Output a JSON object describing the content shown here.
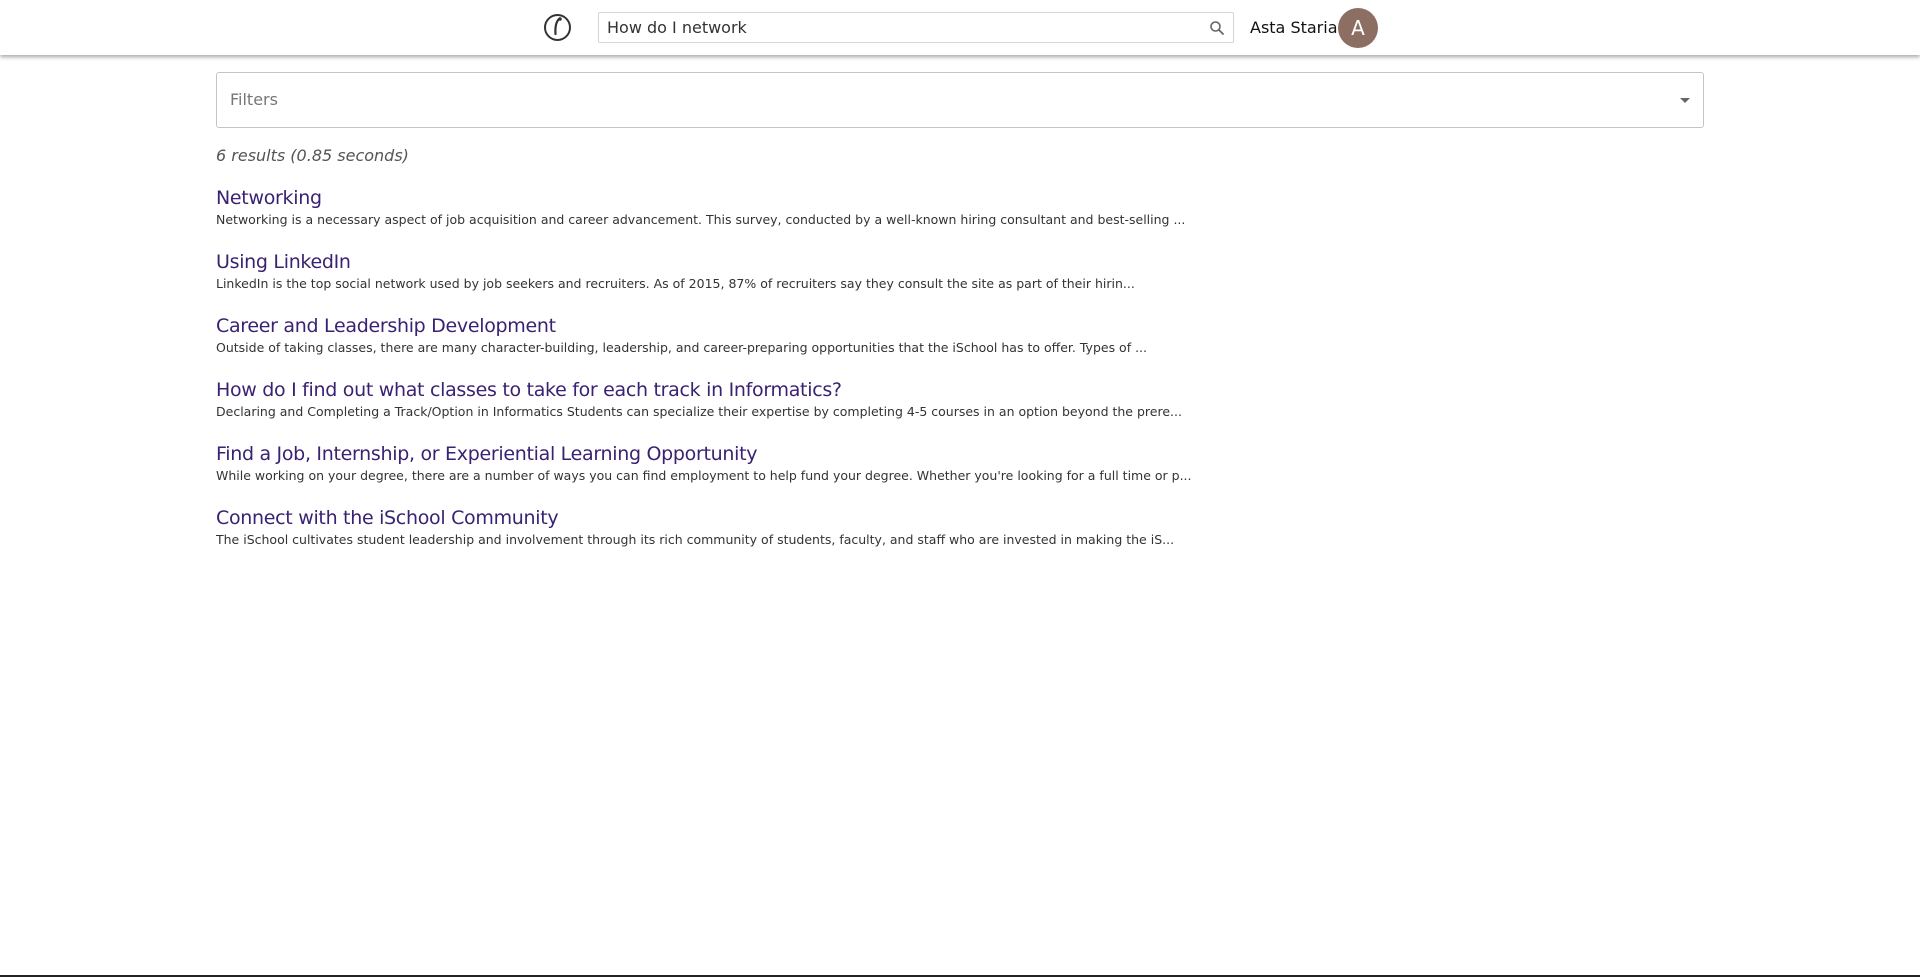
{
  "header": {
    "logo_icon": "ischool-logo-icon",
    "search": {
      "value": "How do I network",
      "placeholder": "",
      "icon": "search-icon"
    },
    "user": {
      "name": "Asta Staria",
      "avatar_initial": "A",
      "avatar_color": "#8d6e63"
    }
  },
  "filters": {
    "label": "Filters",
    "icon": "dropdown-arrow-icon"
  },
  "results_summary": "6 results (0.85 seconds)",
  "results": [
    {
      "title": "Networking",
      "snippet": "Networking is a necessary aspect of job acquisition and career advancement. This survey, conducted by a well-known hiring consultant and best-selling ..."
    },
    {
      "title": "Using LinkedIn",
      "snippet": "LinkedIn is the top social network used by job seekers and recruiters. As of 2015,  87% of recruiters say they consult the site as part of their hirin..."
    },
    {
      "title": "Career and Leadership Development",
      "snippet": "Outside of taking classes, there are many character-building, leadership, and career-preparing opportunities that the iSchool has to offer.  Types of ..."
    },
    {
      "title": "How do I find out what classes to take for each track in Informatics?",
      "snippet": "Declaring and Completing a Track/Option in Informatics Students can specialize their expertise by completing 4-5 courses in an option beyond the prere..."
    },
    {
      "title": "Find a Job, Internship, or Experiential Learning Opportunity",
      "snippet": "While working on your degree, there are a number of ways you can find employment to help fund your degree. Whether you're looking for a full time or p..."
    },
    {
      "title": "Connect with the iSchool Community",
      "snippet": "The iSchool cultivates student leadership and involvement through its rich community of students, faculty, and staff who are invested in making the iS..."
    }
  ],
  "colors": {
    "title_link": "#3a2272",
    "snippet_text": "#333333",
    "header_bg": "#ffffff"
  }
}
